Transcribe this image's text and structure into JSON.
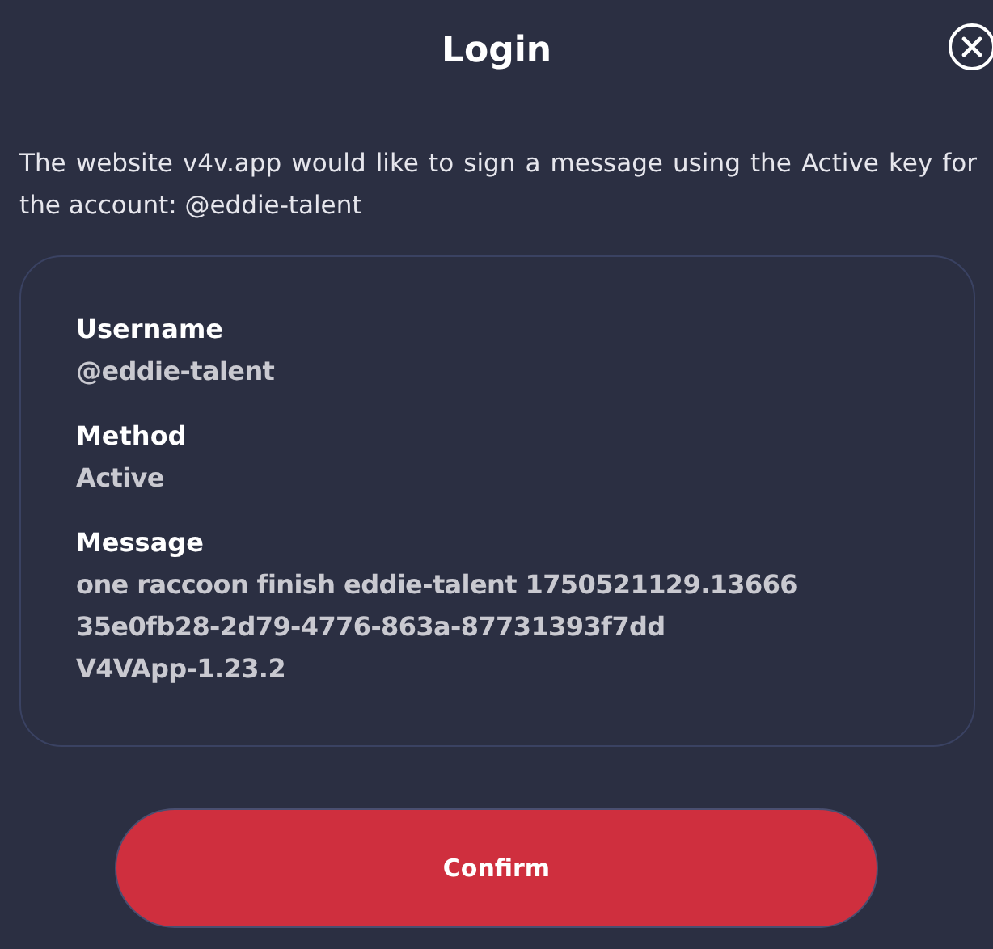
{
  "dialog": {
    "title": "Login",
    "description": "The website v4v.app would like to sign a message using the Active key for the account: @eddie-talent"
  },
  "fields": [
    {
      "label": "Username",
      "lines": [
        "@eddie-talent"
      ]
    },
    {
      "label": "Method",
      "lines": [
        "Active"
      ]
    },
    {
      "label": "Message",
      "lines": [
        "one raccoon finish eddie-talent 1750521129.13666",
        "35e0fb28-2d79-4776-863a-87731393f7dd",
        "V4VApp-1.23.2"
      ]
    }
  ],
  "buttons": [
    {
      "label": "Confirm"
    }
  ]
}
